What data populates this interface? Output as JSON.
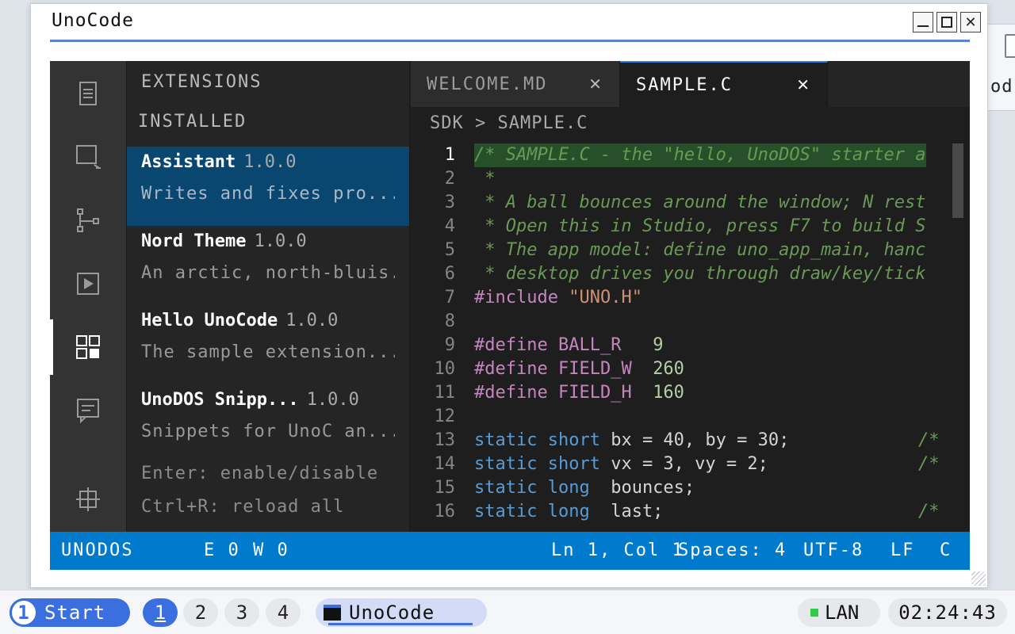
{
  "window": {
    "title": "UnoCode",
    "controls": {
      "minimize": "minimize",
      "maximize": "maximize",
      "close": "✕"
    }
  },
  "background_window": {
    "label": "od"
  },
  "sidebar": {
    "title": "EXTENSIONS",
    "section": "INSTALLED",
    "extensions": [
      {
        "name": "Assistant",
        "version": "1.0.0",
        "description": "Writes and fixes pro..."
      },
      {
        "name": "Nord Theme",
        "version": "1.0.0",
        "description": "An arctic, north-bluis..."
      },
      {
        "name": "Hello UnoCode",
        "version": "1.0.0",
        "description": "The sample extension..."
      },
      {
        "name": "UnoDOS Snipp...",
        "version": "1.0.0",
        "description": "Snippets for UnoC an..."
      }
    ],
    "hints": [
      "Enter: enable/disable",
      "Ctrl+R: reload all"
    ]
  },
  "tabs": [
    {
      "label": "WELCOME.MD",
      "close": "✕"
    },
    {
      "label": "SAMPLE.C",
      "close": "✕"
    }
  ],
  "breadcrumb": "SDK > SAMPLE.C",
  "code": {
    "line_numbers": [
      "1",
      "2",
      "3",
      "4",
      "5",
      "6",
      "7",
      "8",
      "9",
      "10",
      "11",
      "12",
      "13",
      "14",
      "15",
      "16"
    ],
    "l1": "/* SAMPLE.C - the \"hello, UnoDOS\" starter a",
    "l2": " *",
    "l3": " * A ball bounces around the window; N rest",
    "l4": " * Open this in Studio, press F7 to build S",
    "l5": " * The app model: define uno_app_main, hanc",
    "l6": " * desktop drives you through draw/key/tick",
    "l7_pp": "#include",
    "l7_str": "\"UNO.H\"",
    "l9_pp": "#define",
    "l9_name": "BALL_R",
    "l9_num": "9",
    "l10_pp": "#define",
    "l10_name": "FIELD_W",
    "l10_num": "260",
    "l11_pp": "#define",
    "l11_name": "FIELD_H",
    "l11_num": "160",
    "l13_kw": "static short",
    "l13_rest": "bx = 40, by = 30;",
    "l13_trail": "/*",
    "l14_kw": "static short",
    "l14_rest": "vx = 3, vy = 2;",
    "l14_trail": "/*",
    "l15_kw": "static long",
    "l15_rest": "bounces;",
    "l16_kw": "static long",
    "l16_rest": "last;",
    "l16_trail": "/*"
  },
  "statusbar": {
    "os": "UNODOS",
    "errors": "E 0",
    "warnings": "W 0",
    "position": "Ln 1, Col 1",
    "indent": "Spaces: 4",
    "encoding": "UTF-8",
    "eol": "LF",
    "language": "C"
  },
  "taskbar": {
    "start_number": "1",
    "start_label": "Start",
    "workspaces": [
      "1",
      "2",
      "3",
      "4"
    ],
    "active_workspace": "1",
    "app_label": "UnoCode",
    "network": "LAN",
    "clock": "02:24:43"
  },
  "colors": {
    "accent": "#3b6fe0",
    "statusbar": "#007acc",
    "selection": "#094771",
    "comment": "#6a9955",
    "keyword": "#569cd6",
    "preprocessor": "#c586c0",
    "number": "#b5cea8"
  }
}
